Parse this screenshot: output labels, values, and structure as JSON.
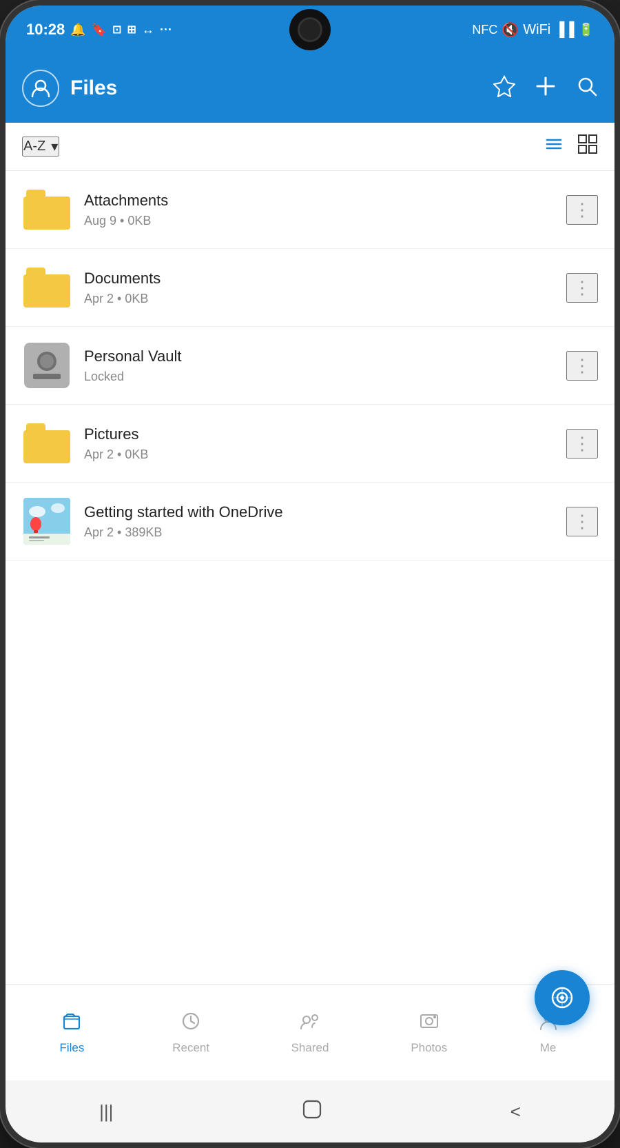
{
  "statusBar": {
    "time": "10:28",
    "icons": [
      "📷",
      "🔖",
      "📋",
      "📶",
      "📶",
      "···"
    ]
  },
  "header": {
    "title": "Files",
    "diamondLabel": "◇",
    "addLabel": "+",
    "searchLabel": "🔍"
  },
  "toolbar": {
    "sortLabel": "A-Z",
    "sortArrow": "▾"
  },
  "files": [
    {
      "name": "Attachments",
      "meta": "Aug 9 • 0KB",
      "type": "folder"
    },
    {
      "name": "Documents",
      "meta": "Apr 2 • 0KB",
      "type": "folder"
    },
    {
      "name": "Personal Vault",
      "meta": "Locked",
      "type": "vault"
    },
    {
      "name": "Pictures",
      "meta": "Apr 2 • 0KB",
      "type": "folder"
    },
    {
      "name": "Getting started with OneDrive",
      "meta": "Apr 2 • 389KB",
      "type": "doc"
    }
  ],
  "bottomNav": [
    {
      "label": "Files",
      "active": true
    },
    {
      "label": "Recent",
      "active": false
    },
    {
      "label": "Shared",
      "active": false
    },
    {
      "label": "Photos",
      "active": false
    },
    {
      "label": "Me",
      "active": false
    }
  ],
  "systemNav": {
    "menu": "|||",
    "home": "○",
    "back": "<"
  }
}
